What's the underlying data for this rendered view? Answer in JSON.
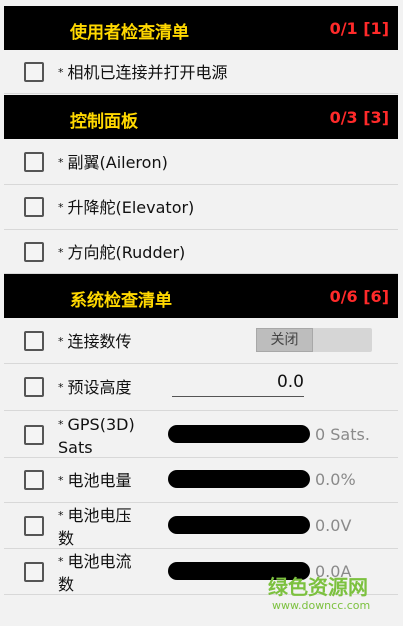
{
  "sections": [
    {
      "title": "使用者检查清单",
      "count": "0/1 [1]",
      "items": [
        {
          "label": "相机已连接并打开电源"
        }
      ]
    },
    {
      "title": "控制面板",
      "count": "0/3 [3]",
      "items": [
        {
          "label": "副翼(Aileron)"
        },
        {
          "label": "升降舵(Elevator)"
        },
        {
          "label": "方向舵(Rudder)"
        }
      ]
    },
    {
      "title": "系统检查清单",
      "count": "0/6 [6]",
      "items": [
        {
          "label": "连接数传",
          "toggle_label": "关闭"
        },
        {
          "label": "预设高度",
          "value": "0.0"
        },
        {
          "label_line1": "GPS(3D)",
          "label_line2": "Sats",
          "value": "0 Sats."
        },
        {
          "label": "电池电量",
          "value": "0.0%"
        },
        {
          "label_line1": "电池电压",
          "label_line2": "数",
          "value": "0.0V"
        },
        {
          "label_line1": "电池电流",
          "label_line2": "数",
          "value": "0.0A"
        }
      ]
    }
  ],
  "star": "*",
  "watermark": {
    "main": "绿色资源网",
    "sub": "www.downcc.com"
  }
}
